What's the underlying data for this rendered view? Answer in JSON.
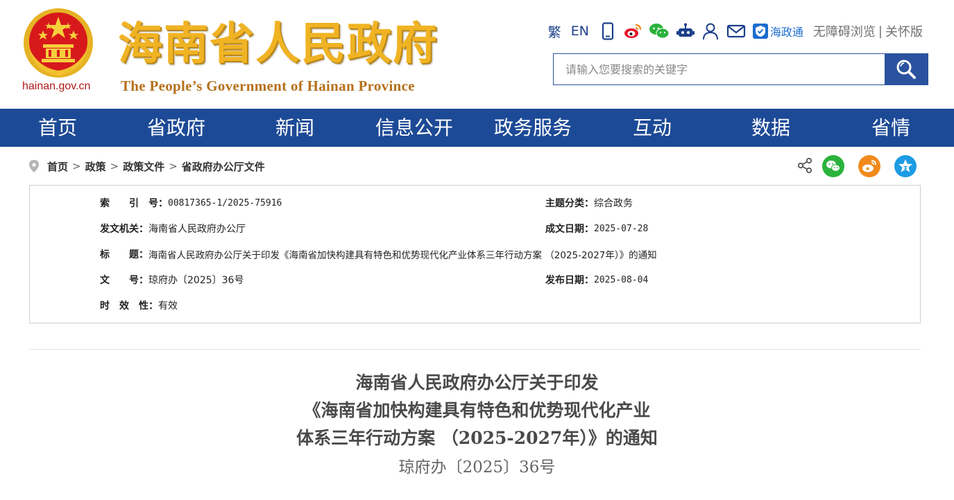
{
  "header": {
    "domain": "hainan.gov.cn",
    "site_title": "海南省人民政府",
    "site_subtitle": "The People’s Government  of Hainan Province",
    "tools": {
      "traditional": "繁",
      "english": "EN",
      "app_name": "海政通",
      "accessibility": "无障碍浏览",
      "separator": "|",
      "elder_mode": "关怀版"
    },
    "search": {
      "placeholder": "请输入您要搜索的关键字"
    }
  },
  "nav": {
    "items": [
      "首页",
      "省政府",
      "新闻",
      "信息公开",
      "政务服务",
      "互动",
      "数据",
      "省情"
    ]
  },
  "breadcrumb": {
    "items": [
      "首页",
      "政策",
      "政策文件",
      "省政府办公厅文件"
    ],
    "arrow": ">"
  },
  "info": {
    "index_label": "索　　引　号：",
    "index_value": "00817365-1/2025-75916",
    "topic_label": "主题分类：",
    "topic_value": "综合政务",
    "issuer_label": "发文机关：",
    "issuer_value": "海南省人民政府办公厅",
    "date_written_label": "成文日期：",
    "date_written_value": "2025-07-28",
    "title_label": "标　　题：",
    "title_value": "海南省人民政府办公厅关于印发《海南省加快构建具有特色和优势现代化产业体系三年行动方案 （2025-2027年）》的通知",
    "docno_label": "文　　号：",
    "docno_value": "琼府办〔2025〕36号",
    "pubdate_label": "发布日期：",
    "pubdate_value": "2025-08-04",
    "validity_label": "时　效　性：",
    "validity_value": "有效"
  },
  "document": {
    "title_lines": [
      "海南省人民政府办公厅关于印发",
      "《海南省加快构建具有特色和优势现代化产业",
      "体系三年行动方案 （2025-2027年）》的通知"
    ],
    "doc_number": "琼府办〔2025〕36号"
  },
  "colors": {
    "nav_bg": "#1d4a96",
    "title_gold": "#f0b323",
    "emblem_red": "#d7191c",
    "wechat_green": "#2bb33c",
    "weibo_orange": "#f28a1c",
    "qzone_blue": "#1d9be5"
  },
  "icons": {
    "emblem": "national-emblem",
    "mobile": "mobile-icon",
    "weibo": "weibo-icon",
    "wechat": "wechat-icon",
    "robot": "robot-icon",
    "user": "user-icon",
    "mail": "mail-icon",
    "search": "search-icon",
    "share": "share-icon"
  }
}
